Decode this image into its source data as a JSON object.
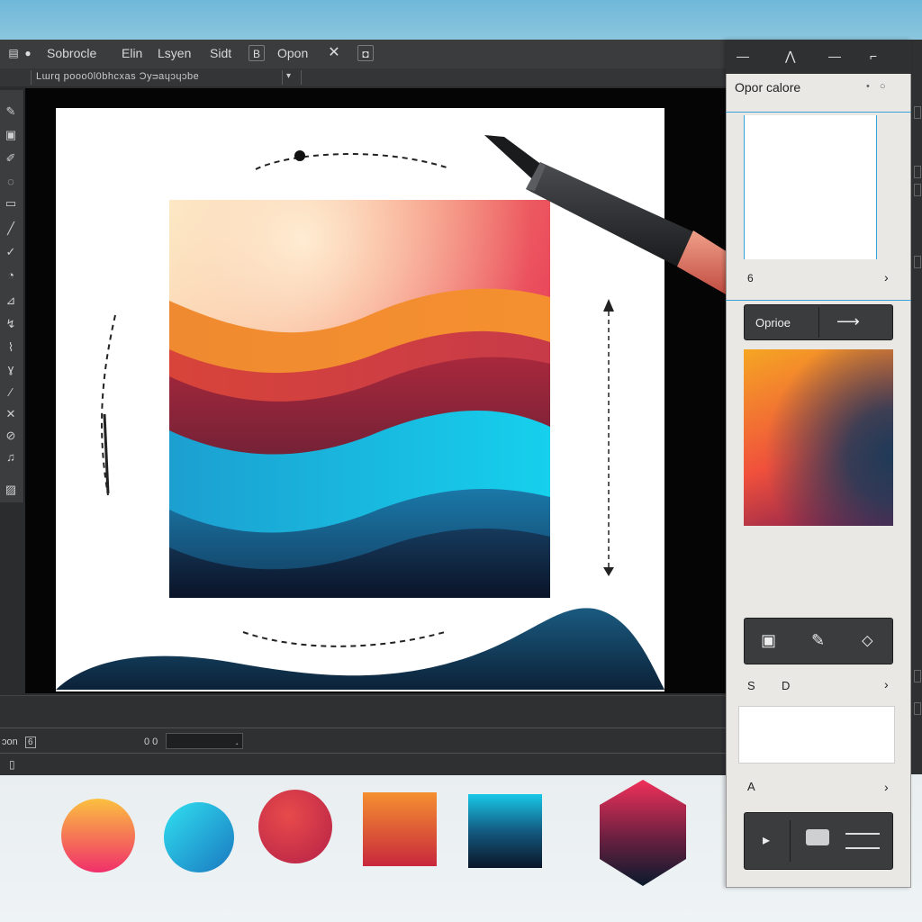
{
  "menu": {
    "items": [
      "Sobrocle",
      "Elin",
      "Lsyen",
      "Sidt",
      "Opon"
    ],
    "icon_left": "●",
    "icon_x": "✕",
    "icon_d": "◘",
    "icon_b": "B"
  },
  "options_bar": {
    "text": "Lɯrq pooo0l0bhcxas  Ɔyᴝaɥɔɥɔbe",
    "dropdown_caret": "▾"
  },
  "tools": {
    "icons": [
      "pen-tool",
      "brush-tool",
      "stamp-tool",
      "eraser-tool",
      "shape-tool",
      "pencil-tool",
      "lasso-tool",
      "bucket-tool",
      "pen-tool",
      "move-tool",
      "smudge-tool",
      "dodge-tool",
      "hand-tool",
      "zoom-tool",
      "text-tool",
      "crop-tool",
      "eyedropper-tool",
      "layer-tool",
      "quickmask-tool"
    ]
  },
  "bottom_bar": {
    "label_left": "ɔon",
    "badge": "6",
    "zoom_label": "0 0",
    "field_caret": "˰",
    "small_icon": "▯"
  },
  "panel": {
    "top_icons": [
      "minimize-icon",
      "chevron-up-icon",
      "line-icon",
      "dropdown-icon"
    ],
    "top_glyphs": [
      "—",
      "⋀",
      "—",
      "⌐"
    ],
    "title": "Opor calore",
    "dots": "• ○",
    "slider1": {
      "label": "6",
      "chevron": "›"
    },
    "option_button": {
      "label": "Oprioe",
      "arrow": "⟶"
    },
    "tool_icons": [
      "frame-icon",
      "brush-icon",
      "fill-icon"
    ],
    "tool_glyphs": [
      "▣",
      "✎",
      "⬦"
    ],
    "sd_row": {
      "s": "S",
      "d": "D",
      "chevron": "›"
    },
    "a_row": {
      "label": "A",
      "chevron": "›"
    },
    "bottom_buttons": {
      "play": "▸",
      "image": "▭"
    }
  },
  "colors": {
    "orange": "#f5a623",
    "coral": "#f0503c",
    "crimson": "#c8283c",
    "cyan": "#1ec8e8",
    "navy": "#0e2238",
    "dark_ui": "#2a2c2e"
  }
}
